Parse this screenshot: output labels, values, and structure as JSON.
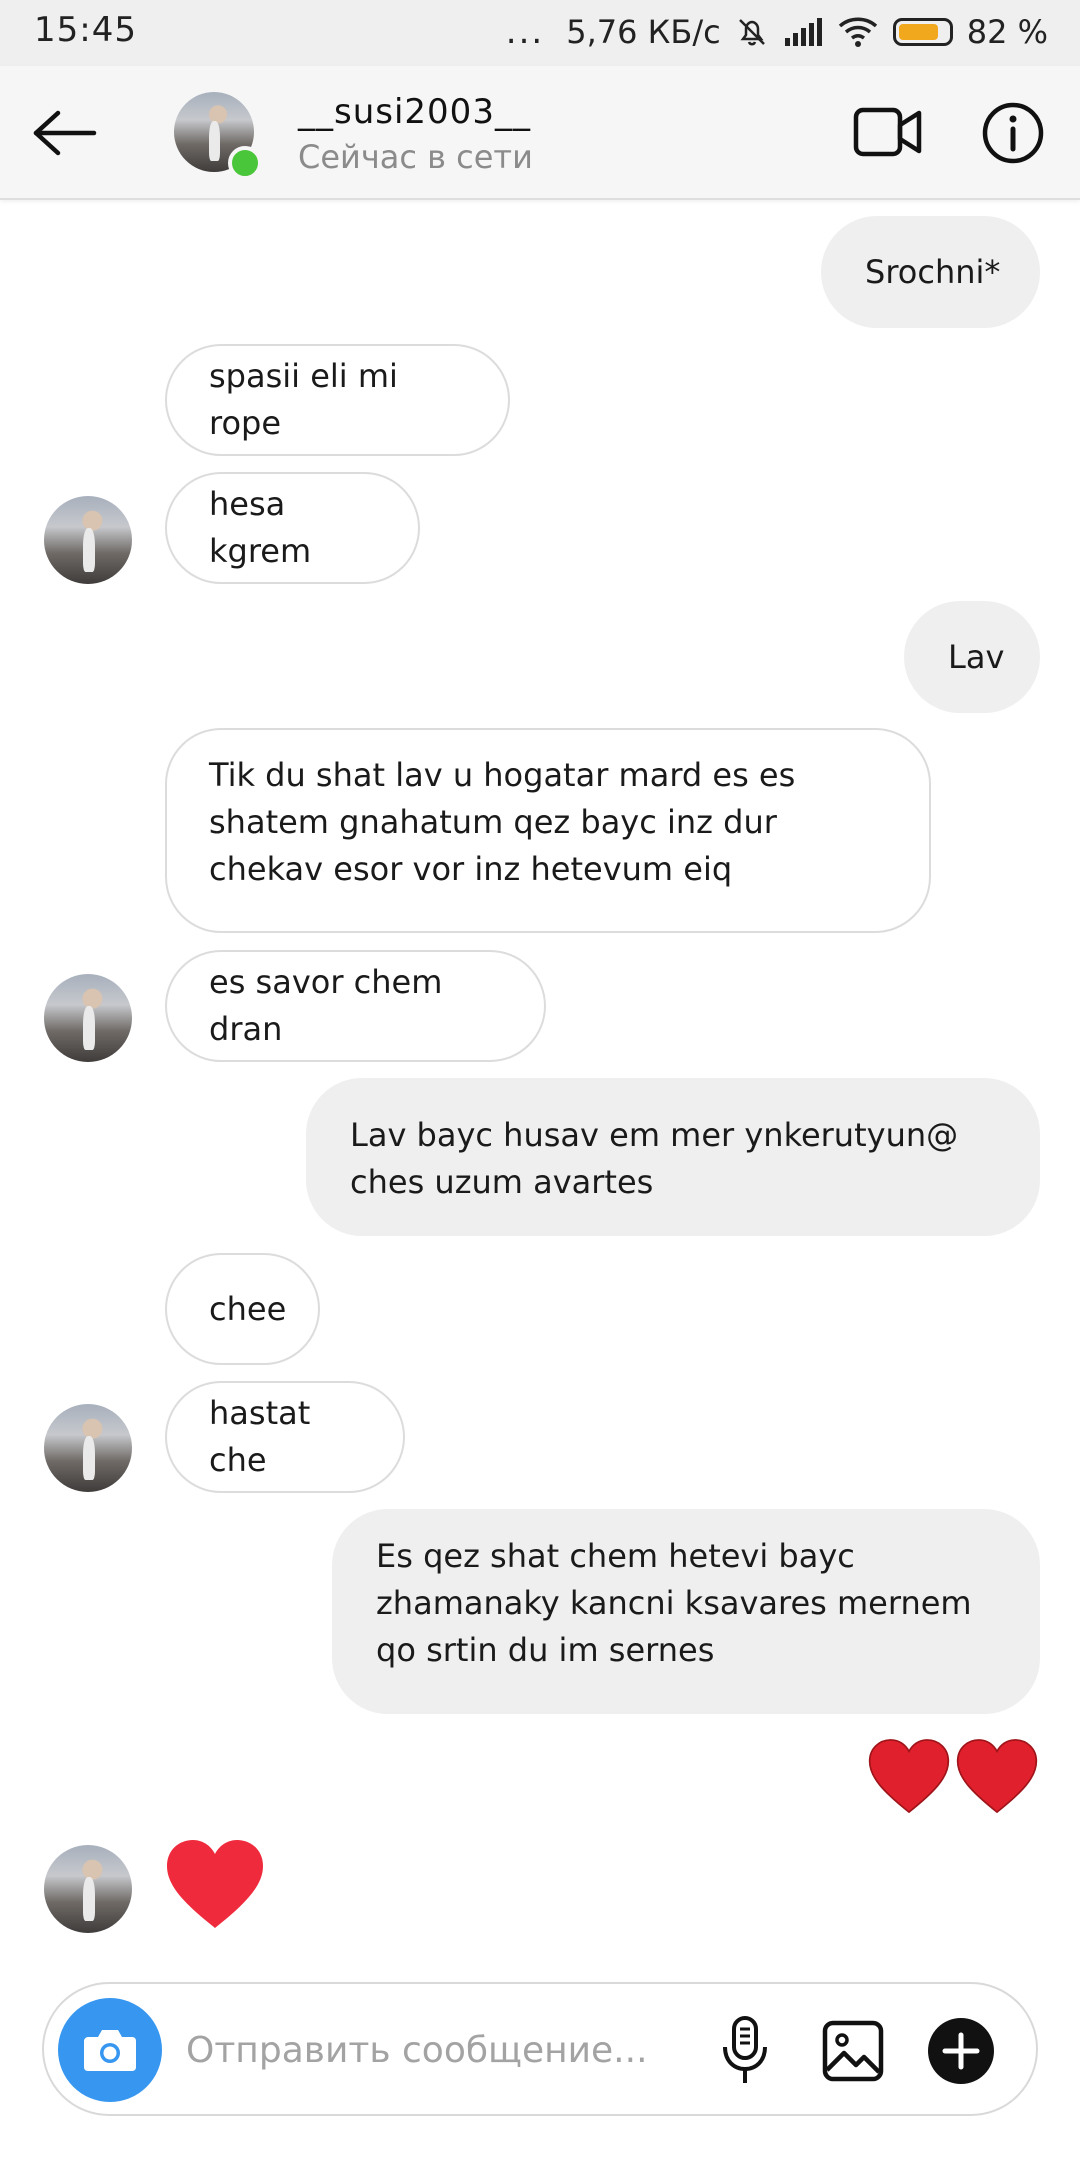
{
  "status_bar": {
    "time": "15:45",
    "dots": "...",
    "network_speed": "5,76 КБ/с",
    "battery_percent": "82 %",
    "battery_level": 0.82
  },
  "header": {
    "contact_name": "__susi2003__",
    "status": "Сейчас в сети",
    "online_color": "#4ac63a"
  },
  "messages": [
    {
      "side": "sent",
      "text": "Srochni*"
    },
    {
      "side": "received",
      "text": "spasii eli mi rope"
    },
    {
      "side": "received",
      "text": "hesa kgrem"
    },
    {
      "side": "sent",
      "text": "Lav"
    },
    {
      "side": "received",
      "text": "Tik du shat lav u hogatar mard es es shatem gnahatum qez bayc inz dur chekav esor vor inz hetevum eiq"
    },
    {
      "side": "received",
      "text": "es savor chem dran"
    },
    {
      "side": "sent",
      "text": "Lav bayc husav em mer ynkerutyun@ ches uzum avartes"
    },
    {
      "side": "received",
      "text": "chee"
    },
    {
      "side": "received",
      "text": "hastat che"
    },
    {
      "side": "sent",
      "text": "Es qez shat chem hetevi bayc zhamanaky kancni ksavares mernem qo srtin du im sernes"
    },
    {
      "side": "sent",
      "type": "emoji",
      "icon": "two-hearts"
    },
    {
      "side": "received",
      "type": "emoji",
      "icon": "heart"
    }
  ],
  "composer": {
    "placeholder": "Отправить сообщение...",
    "accent_color": "#3797f0"
  },
  "colors": {
    "sent_bubble": "#efefef",
    "received_border": "#dcdcdc",
    "heart": "#e0212d",
    "heart_received": "#ef2a3c"
  }
}
